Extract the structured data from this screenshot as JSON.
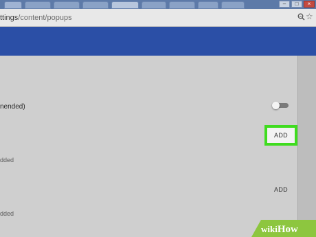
{
  "address_bar": {
    "url_host": "ttings",
    "url_path": "/content/popups",
    "zoom_icon": "zoom-icon",
    "bookmark_icon": "star-icon"
  },
  "window_controls": {
    "minimize": "–",
    "maximize": "□",
    "close": "×"
  },
  "content": {
    "popups_label": "nended)",
    "popups_toggle_on": false,
    "block_add_label": "ADD",
    "block_empty_text": "dded",
    "allow_add_label": "ADD",
    "allow_empty_text": "dded"
  },
  "colors": {
    "header_blue": "#2b4fa6",
    "highlight_green": "#3fdc1f",
    "watermark_green": "#8dc63f"
  },
  "watermark": {
    "prefix": "wiki",
    "suffix": "How"
  }
}
